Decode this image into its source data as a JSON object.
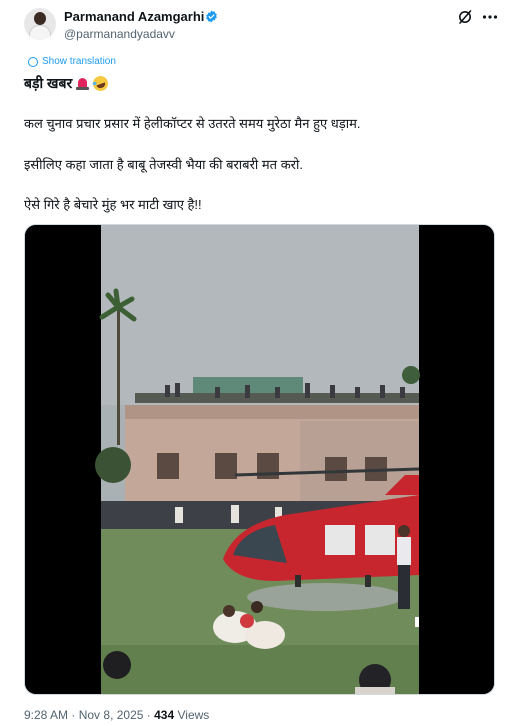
{
  "author": {
    "display_name": "Parmanand Azamgarhi",
    "handle": "@parmanandyadavv"
  },
  "translate": {
    "label": "Show translation"
  },
  "post": {
    "headline": "बड़ी खबर",
    "line1": "कल चुनाव प्रचार प्रसार में हेलीकॉप्टर से उतरते समय मुरेठा मैन हुए धड़ाम.",
    "line2": "इसीलिए कहा जाता है बाबू तेजस्वी भैया की बराबरी मत करो.",
    "line3": "ऐसे गिरे है बेचारे मुंह भर माटी खाए है!!"
  },
  "media": {
    "type": "video"
  },
  "meta": {
    "time": "9:28 AM",
    "separator": "·",
    "date": "Nov 8, 2025",
    "views_count": "434",
    "views_label": "Views"
  },
  "colors": {
    "accent": "#1d9bf0",
    "text": "#0f1419",
    "muted": "#536471",
    "helicopter": "#c8262e"
  }
}
